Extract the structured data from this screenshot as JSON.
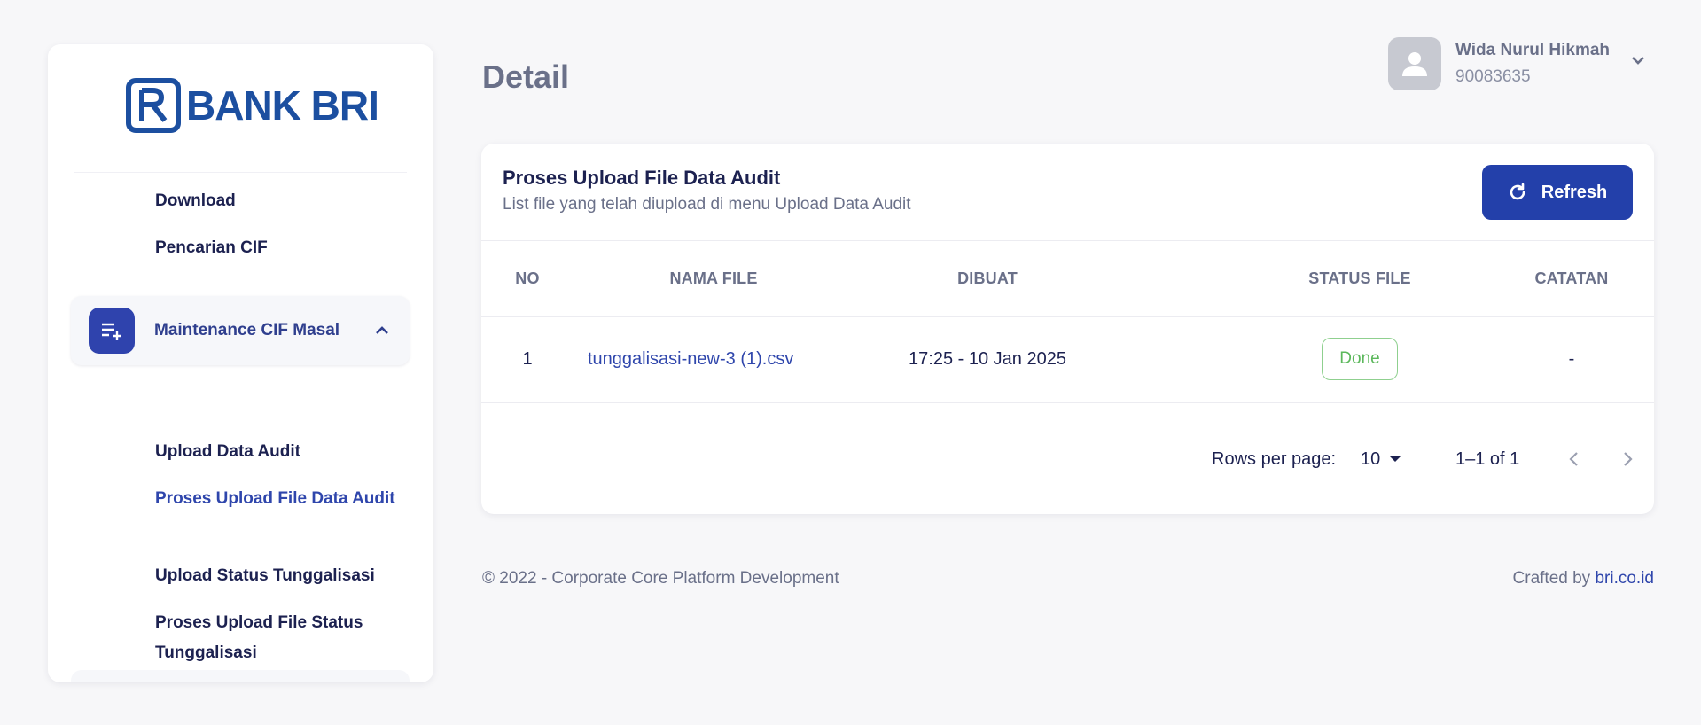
{
  "sidebar": {
    "logo_text": "BANK BRI",
    "links_top": [
      "Download",
      "Pencarian CIF"
    ],
    "group": {
      "label": "Maintenance CIF Masal",
      "icon": "playlist-add-icon",
      "expanded": true,
      "items": [
        {
          "label": "Upload Data Audit",
          "active": false
        },
        {
          "label": "Proses Upload File Data Audit",
          "active": true
        },
        {
          "label": "Upload Status Tunggalisasi",
          "active": false
        },
        {
          "label": "Proses Upload File Status Tunggalisasi",
          "active": false
        }
      ]
    }
  },
  "header": {
    "title": "Detail",
    "user": {
      "name": "Wida Nurul Hikmah",
      "id": "90083635"
    }
  },
  "card": {
    "title": "Proses Upload File Data Audit",
    "subtitle": "List file yang telah diupload di menu Upload Data Audit",
    "refresh_label": "Refresh",
    "columns": [
      "NO",
      "NAMA FILE",
      "DIBUAT",
      "STATUS FILE",
      "CATATAN"
    ],
    "rows": [
      {
        "no": "1",
        "nama_file": "tunggalisasi-new-3 (1).csv",
        "dibuat": "17:25 - 10 Jan 2025",
        "status": "Done",
        "catatan": "-"
      }
    ],
    "pagination": {
      "rows_per_page_label": "Rows per page:",
      "rows_per_page": "10",
      "range": "1–1 of 1"
    }
  },
  "footer": {
    "copyright": "© 2022 - Corporate Core Platform Development",
    "crafted_prefix": "Crafted by ",
    "crafted_link": "bri.co.id"
  },
  "colors": {
    "accent": "#2340aa",
    "logo": "#1c4fa0",
    "status_done": "#5cb85c",
    "background": "#f7f7f9"
  }
}
